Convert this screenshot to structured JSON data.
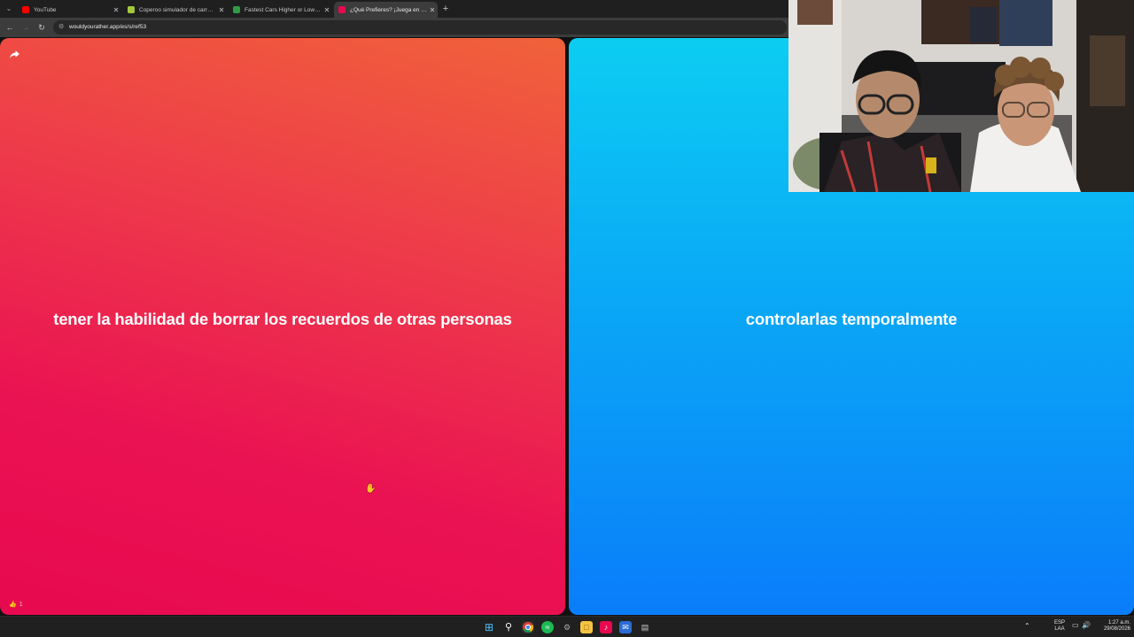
{
  "browser": {
    "tabs": [
      {
        "title": "YouTube",
        "favicon_color": "#ff0000",
        "active": false
      },
      {
        "title": "Coperoo simulador de carrera l",
        "favicon_color": "#a3c93a",
        "active": false
      },
      {
        "title": "Fastest Cars Higher or Lower G",
        "favicon_color": "#2e9e44",
        "active": false
      },
      {
        "title": "¿Qué Prefieres? ¡Juega en línea!",
        "favicon_color": "#e8094f",
        "active": true
      }
    ],
    "new_tab_icon": "plus-icon",
    "url": "wouldyourather.app/es/s/ref53"
  },
  "game": {
    "left_option": "tener la habilidad de borrar los recuerdos de otras personas",
    "right_option": "controlarlas temporalmente",
    "likes": "1",
    "left_color": "#ea1252",
    "right_color": "#0aa8f6"
  },
  "taskbar": {
    "language_top": "ESP",
    "language_bottom": "LAA",
    "time": "1:27 a.m.",
    "date": "29/08/2026"
  }
}
